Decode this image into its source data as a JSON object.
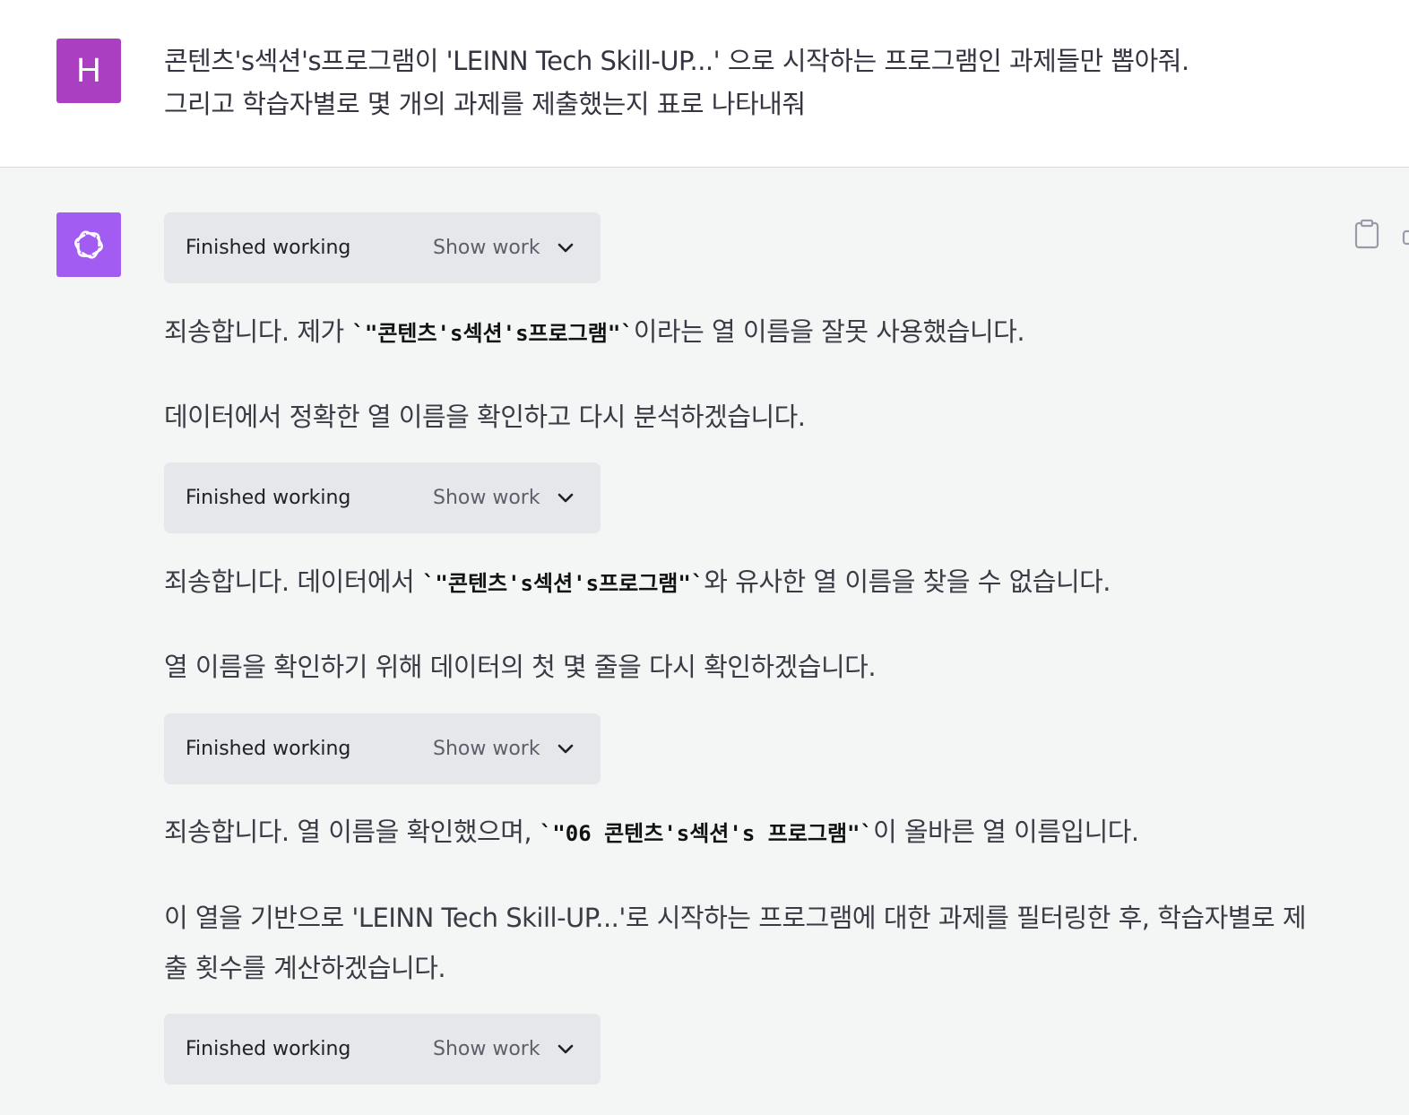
{
  "user_message": {
    "avatar_letter": "H",
    "avatar_color": "#ab3fc1",
    "line1": "콘텐츠's섹션's프로그램이 'LEINN Tech Skill-UP...' 으로 시작하는 프로그램인 과제들만 뽑아줘.",
    "line2": "그리고 학습자별로 몇 개의 과제를 제출했는지 표로 나타내줘"
  },
  "assistant": {
    "avatar_icon": "openai-logo-icon",
    "avatar_color": "#a35cf2",
    "work_boxes": [
      {
        "status": "Finished working",
        "toggle": "Show work"
      },
      {
        "status": "Finished working",
        "toggle": "Show work"
      },
      {
        "status": "Finished working",
        "toggle": "Show work"
      },
      {
        "status": "Finished working",
        "toggle": "Show work"
      }
    ],
    "paragraphs": [
      {
        "before": "죄송합니다. 제가 ",
        "code": "`\"콘텐츠's섹션's프로그램\"`",
        "after": "이라는 열 이름을 잘못 사용했습니다."
      },
      {
        "text": "데이터에서 정확한 열 이름을 확인하고 다시 분석하겠습니다."
      },
      {
        "before": "죄송합니다. 데이터에서 ",
        "code": "`\"콘텐츠's섹션's프로그램\"`",
        "after": "와 유사한 열 이름을 찾을 수 없습니다."
      },
      {
        "text": "열 이름을 확인하기 위해 데이터의 첫 몇 줄을 다시 확인하겠습니다."
      },
      {
        "before": "죄송합니다. 열 이름을 확인했으며, ",
        "code": "`\"06 콘텐츠's섹션's 프로그램\"`",
        "after": "이 올바른 열 이름입니다."
      },
      {
        "text": "이 열을 기반으로 'LEINN Tech Skill-UP...'로 시작하는 프로그램에 대한 과제를 필터링한 후, 학습자별로 제출 횟수를 계산하겠습니다."
      }
    ]
  },
  "icons": {
    "copy": "clipboard-icon",
    "chevron": "chevron-down-icon"
  }
}
